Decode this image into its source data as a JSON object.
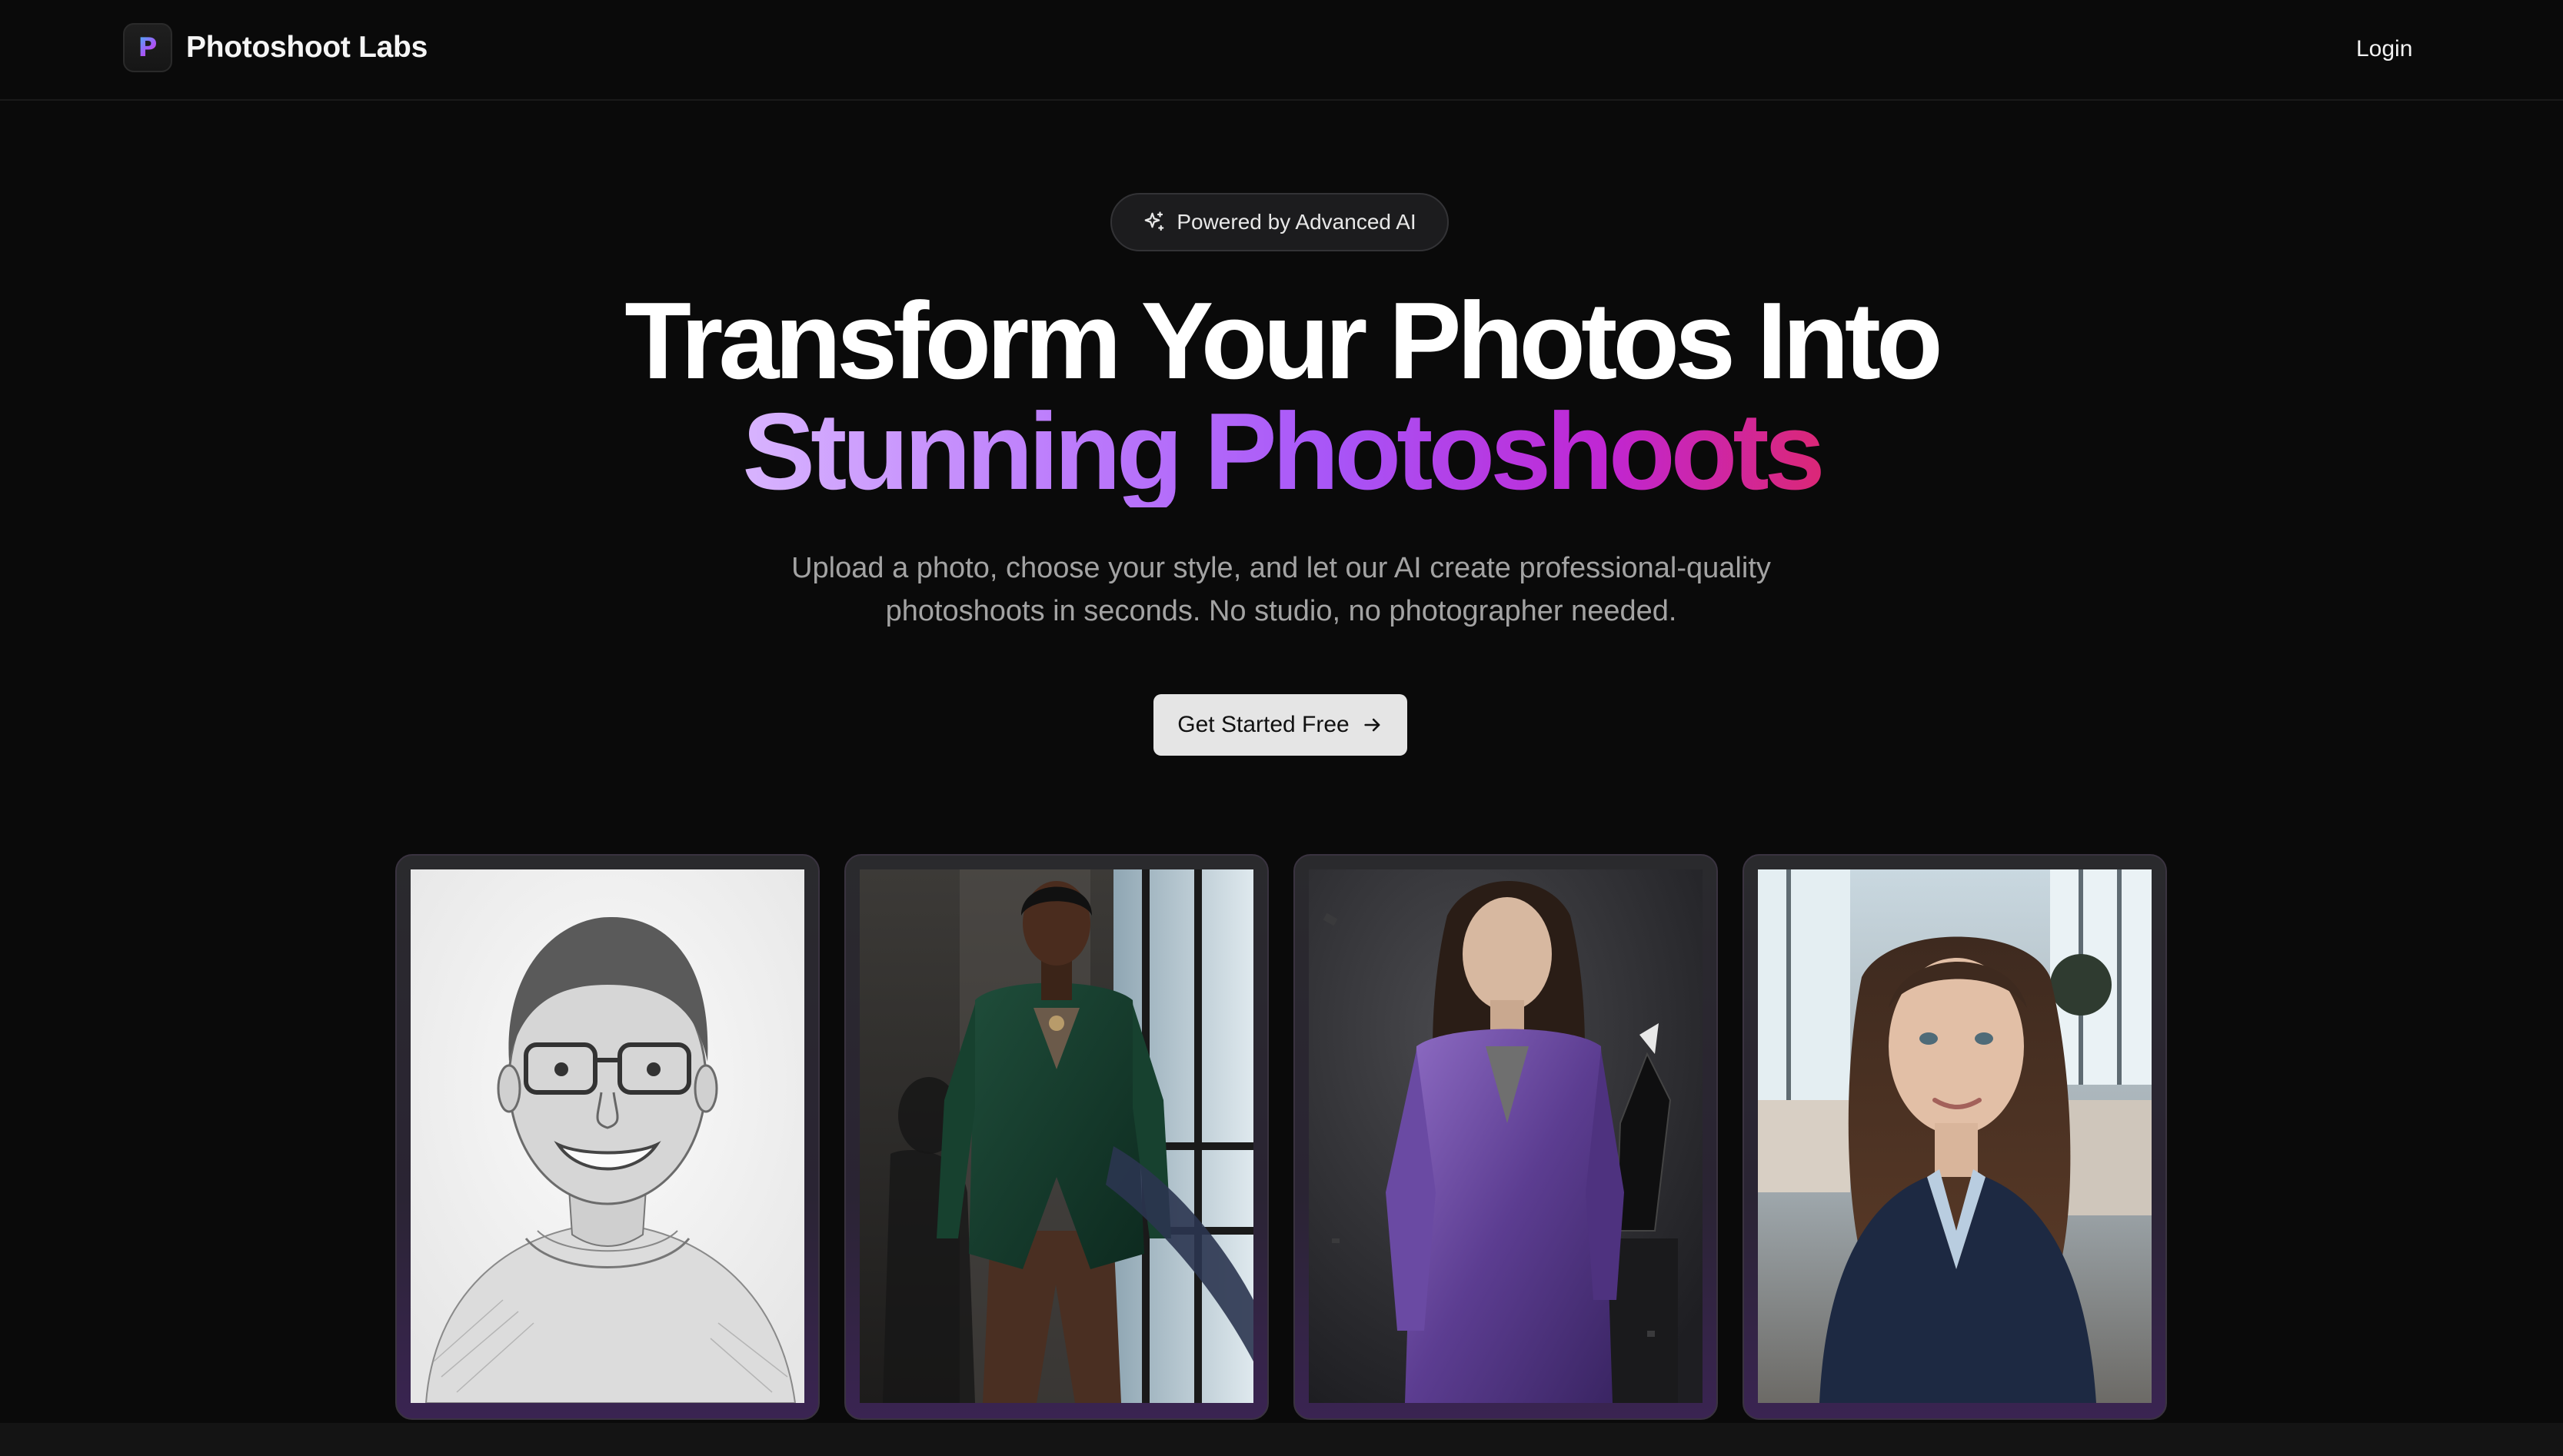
{
  "header": {
    "logo_letter": "P",
    "brand_name": "Photoshoot Labs",
    "login_label": "Login"
  },
  "hero": {
    "badge_icon": "sparkles-icon",
    "badge_text": "Powered by Advanced AI",
    "headline_line1": "Transform Your Photos Into",
    "headline_line2": "Stunning Photoshoots",
    "subtitle_line1": "Upload a photo, choose your style, and let our AI create professional-quality",
    "subtitle_line2": "photoshoots in seconds. No studio, no photographer needed.",
    "cta_label": "Get Started Free",
    "cta_icon": "arrow-right-icon"
  },
  "gallery": [
    {
      "style": "pencil-sketch-portrait"
    },
    {
      "style": "green-velvet-fashion"
    },
    {
      "style": "purple-suit-editorial"
    },
    {
      "style": "office-headshot"
    }
  ],
  "colors": {
    "background": "#0a0a0a",
    "gradient_start": "#d8b4fe",
    "gradient_mid": "#a855f7",
    "gradient_end": "#db2777",
    "cta_background": "#e5e5e5"
  }
}
